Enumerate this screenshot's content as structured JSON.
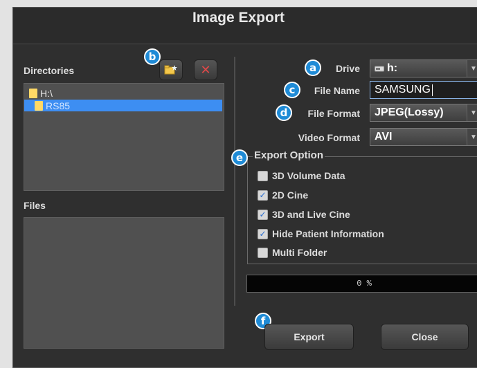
{
  "dialog": {
    "title": "Image Export"
  },
  "left": {
    "directories_label": "Directories",
    "files_label": "Files",
    "tree": [
      {
        "label": "H:\\"
      },
      {
        "label": "RS85"
      }
    ]
  },
  "form": {
    "drive_label": "Drive",
    "drive_value": "h:",
    "file_name_label": "File Name",
    "file_name_value": "SAMSUNG",
    "file_format_label": "File Format",
    "file_format_value": "JPEG(Lossy)",
    "video_format_label": "Video Format",
    "video_format_value": "AVI"
  },
  "export_option": {
    "title": "Export Option",
    "items": [
      {
        "label": "3D Volume Data",
        "checked": false
      },
      {
        "label": "2D Cine",
        "checked": true
      },
      {
        "label": "3D and Live Cine",
        "checked": true
      },
      {
        "label": "Hide Patient Information",
        "checked": true
      },
      {
        "label": "Multi Folder",
        "checked": false
      }
    ]
  },
  "progress": {
    "text": "0 %",
    "percent": 0
  },
  "buttons": {
    "export": "Export",
    "close": "Close"
  },
  "badges": {
    "a": "a",
    "b": "b",
    "c": "c",
    "d": "d",
    "e": "e",
    "f": "f"
  },
  "icons": {
    "new_folder": "new-folder-icon",
    "delete": "delete-icon",
    "drive": "drive-icon",
    "dropdown": "chevron-down-icon"
  },
  "colors": {
    "accent": "#1f8bd6",
    "selection": "#3d8ef2",
    "delete": "#e04848"
  }
}
